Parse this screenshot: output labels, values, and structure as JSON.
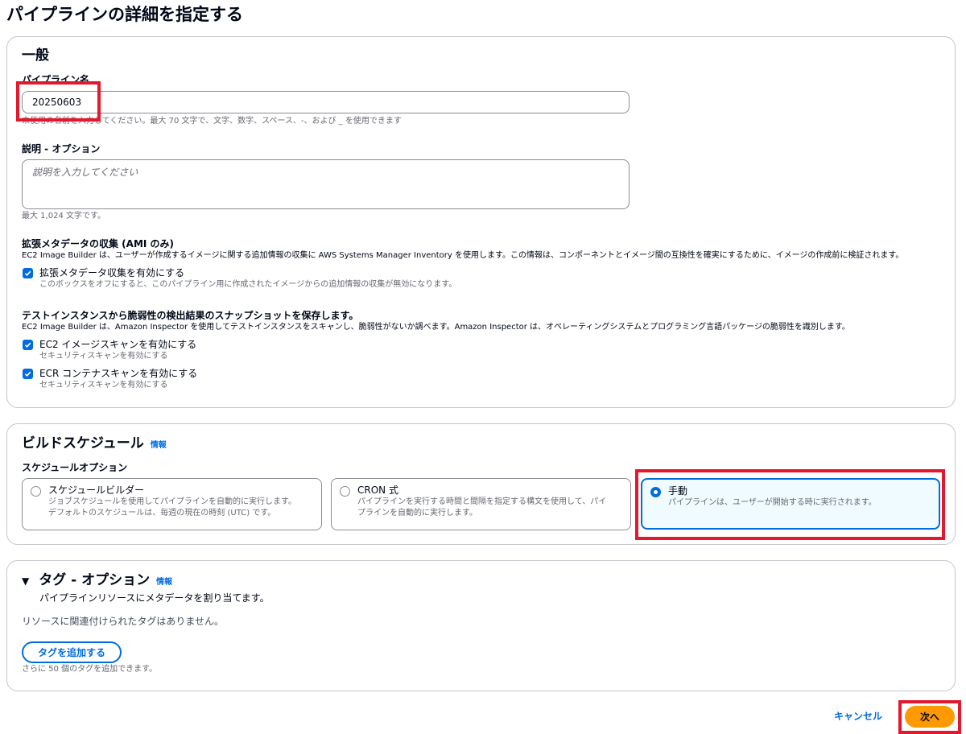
{
  "page": {
    "title": "パイプラインの詳細を指定する"
  },
  "general": {
    "heading": "一般",
    "name_label": "パイプライン名",
    "name_value": "20250603",
    "name_hint": "未使用の名前を入力してください。最大 70 文字で、文字、数字、スペース、-、および _ を使用できます",
    "desc_label": "説明 - オプション",
    "desc_placeholder": "説明を入力してください",
    "desc_hint": "最大 1,024 文字です。",
    "metadata_label": "拡張メタデータの収集 (AMI のみ)",
    "metadata_desc": "EC2 Image Builder は、ユーザーが作成するイメージに関する追加情報の収集に AWS Systems Manager Inventory を使用します。この情報は、コンポーネントとイメージ間の互換性を確実にするために、イメージの作成前に検証されます。",
    "metadata_checkbox_label": "拡張メタデータ収集を有効にする",
    "metadata_checkbox_hint": "このボックスをオフにすると、このパイプライン用に作成されたイメージからの追加情報の収集が無効になります。",
    "snapshot_label": "テストインスタンスから脆弱性の検出結果のスナップショットを保存します。",
    "snapshot_desc": "EC2 Image Builder は、Amazon Inspector を使用してテストインスタンスをスキャンし、脆弱性がないか調べます。Amazon Inspector は、オペレーティングシステムとプログラミング言語パッケージの脆弱性を識別します。",
    "ec2_scan_label": "EC2 イメージスキャンを有効にする",
    "ec2_scan_hint": "セキュリティスキャンを有効にする",
    "ecr_scan_label": "ECR コンテナスキャンを有効にする",
    "ecr_scan_hint": "セキュリティスキャンを有効にする"
  },
  "schedule": {
    "heading": "ビルドスケジュール",
    "info": "情報",
    "options_label": "スケジュールオプション",
    "options": [
      {
        "title": "スケジュールビルダー",
        "desc1": "ジョブスケジュールを使用してパイプラインを自動的に実行します。",
        "desc2": "デフォルトのスケジュールは、毎週の現在の時刻 (UTC) です。",
        "selected": false
      },
      {
        "title": "CRON 式",
        "desc1": "パイプラインを実行する時間と間隔を指定する構文を使用して、パイ",
        "desc2": "プラインを自動的に実行します。",
        "selected": false
      },
      {
        "title": "手動",
        "desc1": "パイプラインは、ユーザーが開始する時に実行されます。",
        "desc2": "",
        "selected": true
      }
    ]
  },
  "tags": {
    "heading": "タグ - オプション",
    "info": "情報",
    "subtitle": "パイプラインリソースにメタデータを割り当てます。",
    "empty": "リソースに関連付けられたタグはありません。",
    "add_button": "タグを追加する",
    "limit_hint": "さらに 50 個のタグを追加できます。"
  },
  "footer": {
    "cancel": "キャンセル",
    "next": "次へ"
  },
  "colors": {
    "accent": "#006ce0",
    "primary_button": "#ff9900",
    "highlight": "#e3182d"
  }
}
